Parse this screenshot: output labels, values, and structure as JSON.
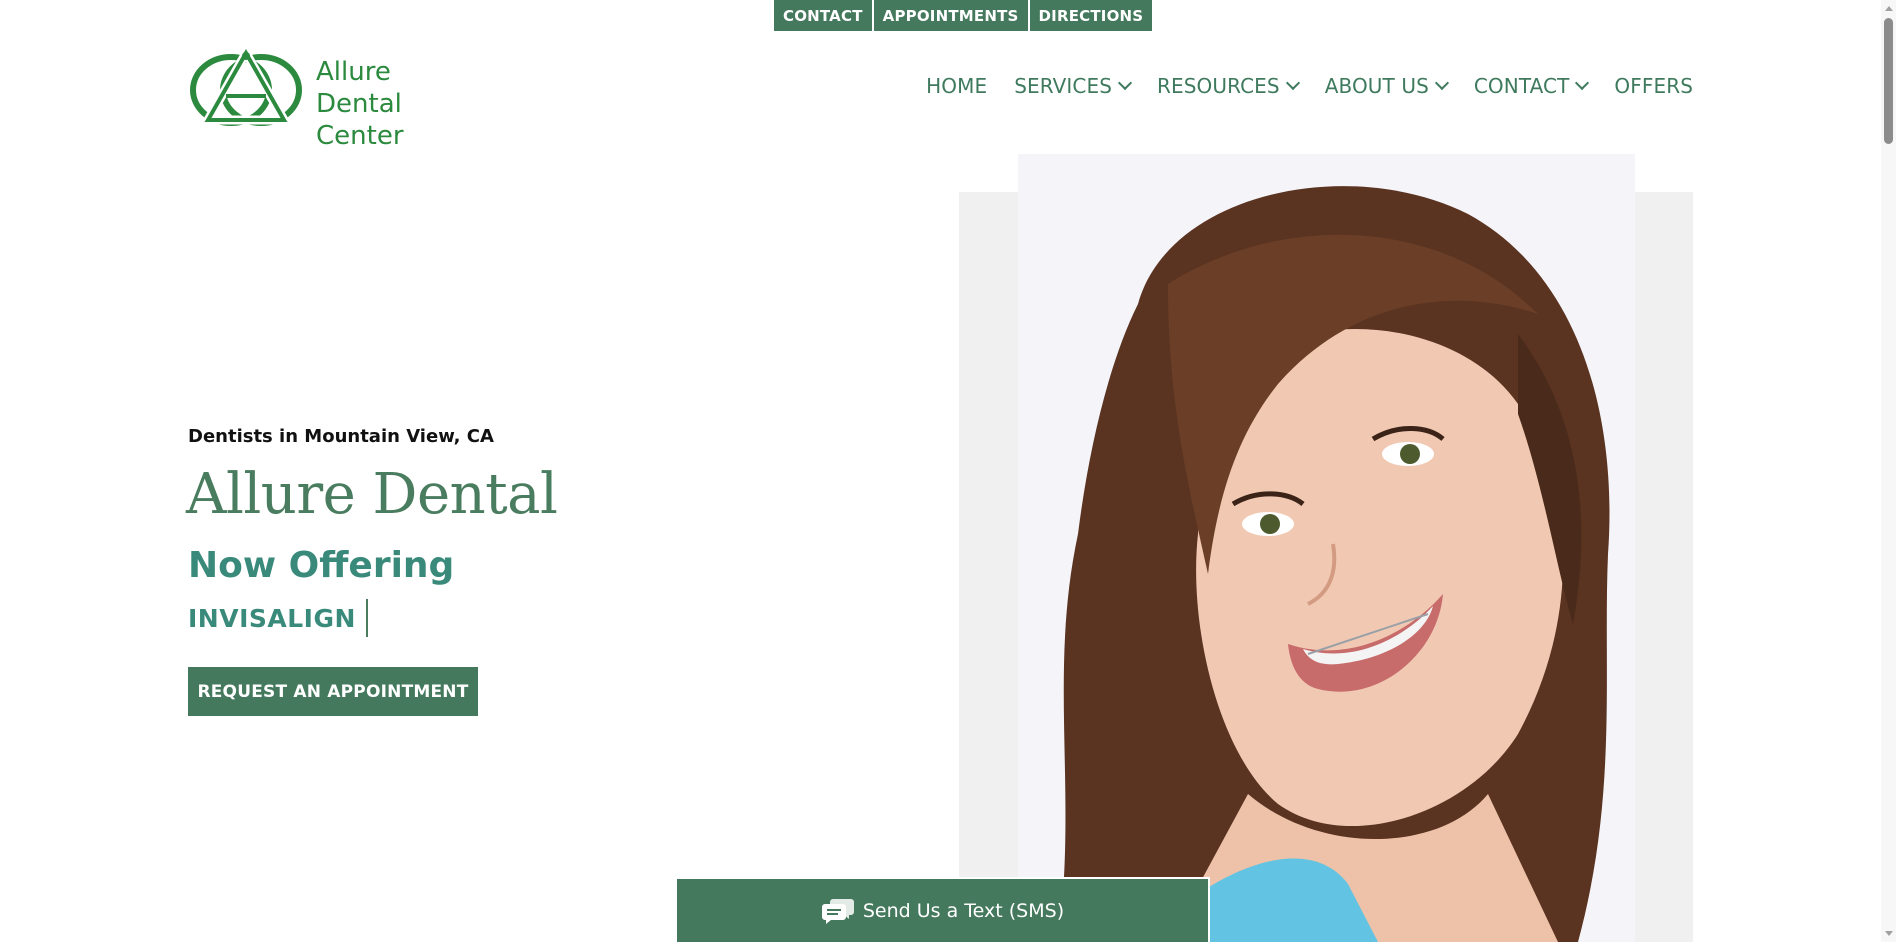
{
  "topbar": {
    "contact": "CONTACT",
    "appointments": "APPOINTMENTS",
    "directions": "DIRECTIONS"
  },
  "logo": {
    "line1": "Allure",
    "line2": "Dental Center"
  },
  "nav": {
    "home": "HOME",
    "services": "SERVICES",
    "resources": "RESOURCES",
    "about": "ABOUT US",
    "contact": "CONTACT",
    "offers": "OFFERS"
  },
  "hero": {
    "kicker": "Dentists in Mountain View, CA",
    "title": "Allure Dental",
    "offering": "Now Offering",
    "typed": "INVISALIGN",
    "cta": "REQUEST AN APPOINTMENT"
  },
  "sms": {
    "label": "Send Us a Text (SMS)"
  },
  "colors": {
    "brand": "#45795d",
    "accent_teal": "#3a8a7b",
    "logo_green": "#2b8a3e"
  }
}
